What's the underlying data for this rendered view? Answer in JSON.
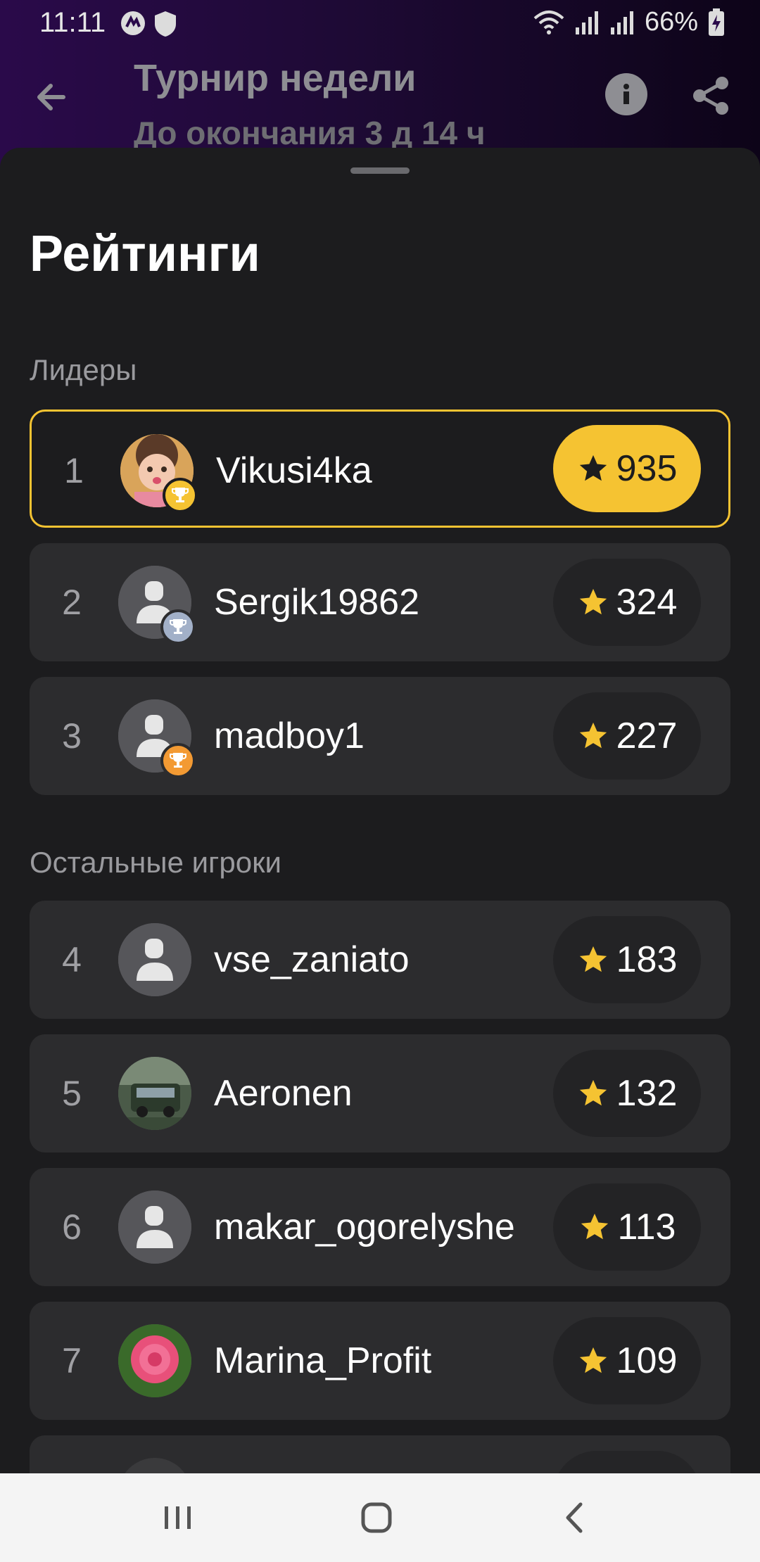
{
  "status_bar": {
    "time": "11:11",
    "battery": "66%"
  },
  "header": {
    "title": "Турнир недели",
    "subtitle": "До окончания 3 д 14 ч"
  },
  "sheet": {
    "title": "Рейтинги",
    "leaders_label": "Лидеры",
    "others_label": "Остальные игроки"
  },
  "leaders": [
    {
      "rank": "1",
      "name": "Vikusi4ka",
      "score": "935",
      "badge": "gold-trophy-icon",
      "avatar": "photo"
    },
    {
      "rank": "2",
      "name": "Sergik19862",
      "score": "324",
      "badge": "silver-trophy-icon",
      "avatar": "default"
    },
    {
      "rank": "3",
      "name": "madboy1",
      "score": "227",
      "badge": "bronze-trophy-icon",
      "avatar": "default"
    }
  ],
  "players": [
    {
      "rank": "4",
      "name": "vse_zaniato",
      "score": "183",
      "avatar": "default"
    },
    {
      "rank": "5",
      "name": "Aeronen",
      "score": "132",
      "avatar": "photo"
    },
    {
      "rank": "6",
      "name": "makar_ogorelyshe",
      "score": "113",
      "avatar": "default"
    },
    {
      "rank": "7",
      "name": "Marina_Profit",
      "score": "109",
      "avatar": "photo"
    }
  ],
  "colors": {
    "accent": "#f5c332",
    "background": "#1c1c1e",
    "row": "#2c2c2e"
  }
}
